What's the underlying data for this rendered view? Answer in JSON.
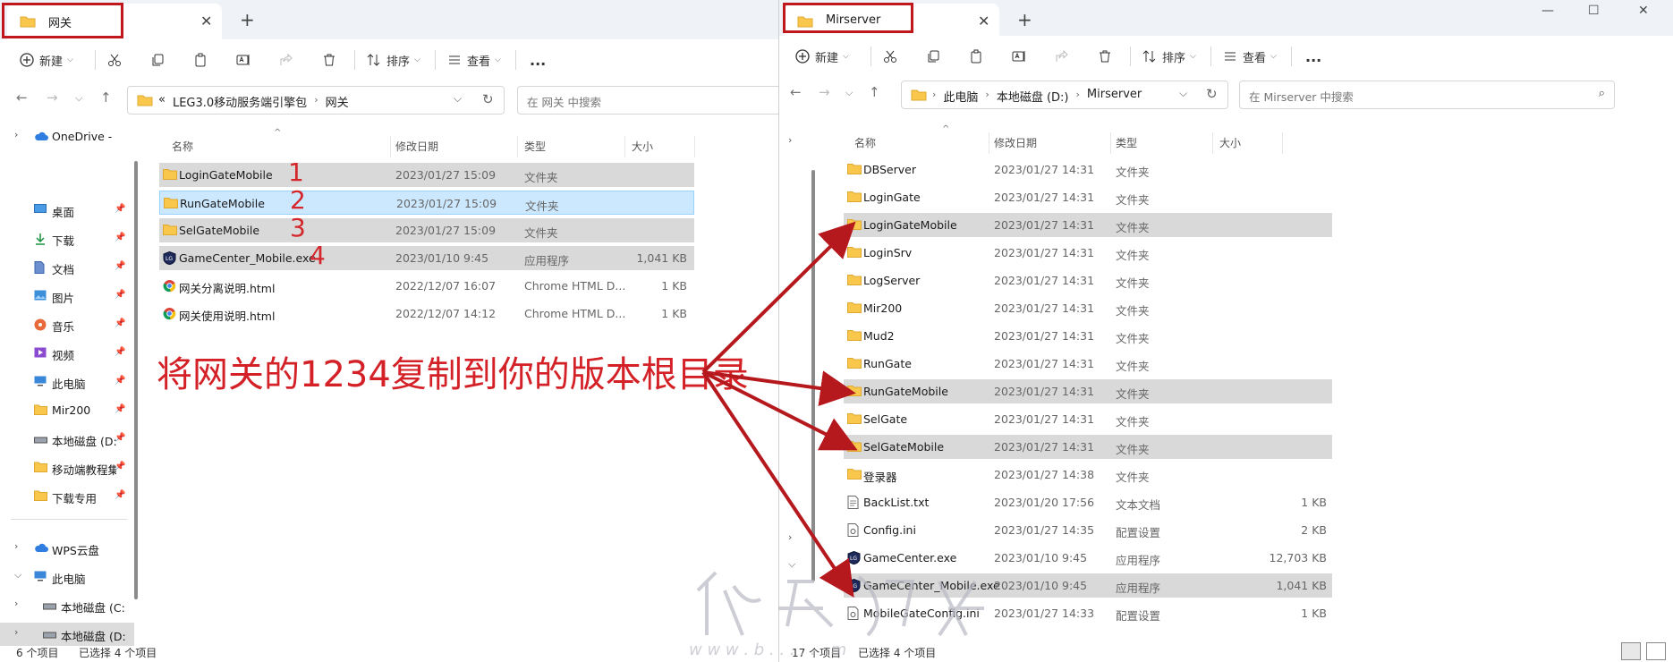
{
  "left": {
    "tab_title": "网关",
    "toolbar": {
      "new": "新建",
      "sort": "排序",
      "view": "查看",
      "more": "..."
    },
    "address": {
      "prefix": "«",
      "crumbs": [
        "LEG3.0移动服务端引擎包",
        "网关"
      ]
    },
    "search_placeholder": "在 网关 中搜索",
    "columns": {
      "name": "名称",
      "date": "修改日期",
      "type": "类型",
      "size": "大小"
    },
    "sidebar": [
      {
        "label": "OneDrive - Per",
        "icon": "cloud-icon"
      },
      {
        "label": "桌面",
        "icon": "desktop-icon"
      },
      {
        "label": "下载",
        "icon": "download-icon"
      },
      {
        "label": "文档",
        "icon": "document-icon"
      },
      {
        "label": "图片",
        "icon": "picture-icon"
      },
      {
        "label": "音乐",
        "icon": "music-icon"
      },
      {
        "label": "视频",
        "icon": "video-icon"
      },
      {
        "label": "此电脑",
        "icon": "computer-icon"
      },
      {
        "label": "Mir200",
        "icon": "folder-icon"
      },
      {
        "label": "本地磁盘 (D:",
        "icon": "drive-icon"
      },
      {
        "label": "移动端教程集",
        "icon": "folder-icon"
      },
      {
        "label": "下载专用",
        "icon": "folder-icon"
      },
      {
        "label": "WPS云盘",
        "icon": "cloud-icon"
      },
      {
        "label": "此电脑",
        "icon": "computer-icon"
      },
      {
        "label": "本地磁盘 (C:)",
        "icon": "drive-icon"
      },
      {
        "label": "本地磁盘 (D:)",
        "icon": "drive-icon"
      }
    ],
    "files": [
      {
        "name": "LoginGateMobile",
        "date": "2023/01/27 15:09",
        "type": "文件夹",
        "size": "",
        "icon": "folder",
        "state": "sel",
        "marker": "1"
      },
      {
        "name": "RunGateMobile",
        "date": "2023/01/27 15:09",
        "type": "文件夹",
        "size": "",
        "icon": "folder",
        "state": "hl",
        "marker": "2"
      },
      {
        "name": "SelGateMobile",
        "date": "2023/01/27 15:09",
        "type": "文件夹",
        "size": "",
        "icon": "folder",
        "state": "sel",
        "marker": "3"
      },
      {
        "name": "GameCenter_Mobile.exe",
        "date": "2023/01/10 9:45",
        "type": "应用程序",
        "size": "1,041 KB",
        "icon": "exe",
        "state": "sel",
        "marker": "4"
      },
      {
        "name": "网关分离说明.html",
        "date": "2022/12/07 16:07",
        "type": "Chrome HTML D...",
        "size": "1 KB",
        "icon": "chrome",
        "state": "",
        "marker": ""
      },
      {
        "name": "网关使用说明.html",
        "date": "2022/12/07 14:12",
        "type": "Chrome HTML D...",
        "size": "1 KB",
        "icon": "chrome",
        "state": "",
        "marker": ""
      }
    ],
    "status": {
      "count": "6 个项目",
      "selected": "已选择 4 个项目"
    }
  },
  "right": {
    "tab_title": "Mirserver",
    "toolbar": {
      "new": "新建",
      "sort": "排序",
      "view": "查看",
      "more": "..."
    },
    "address": {
      "crumbs": [
        "此电脑",
        "本地磁盘 (D:)",
        "Mirserver"
      ]
    },
    "search_placeholder": "在 Mirserver 中搜索",
    "columns": {
      "name": "名称",
      "date": "修改日期",
      "type": "类型",
      "size": "大小"
    },
    "files": [
      {
        "name": "DBServer",
        "date": "2023/01/27 14:31",
        "type": "文件夹",
        "size": "",
        "icon": "folder",
        "state": ""
      },
      {
        "name": "LoginGate",
        "date": "2023/01/27 14:31",
        "type": "文件夹",
        "size": "",
        "icon": "folder",
        "state": ""
      },
      {
        "name": "LoginGateMobile",
        "date": "2023/01/27 14:31",
        "type": "文件夹",
        "size": "",
        "icon": "folder",
        "state": "sel"
      },
      {
        "name": "LoginSrv",
        "date": "2023/01/27 14:31",
        "type": "文件夹",
        "size": "",
        "icon": "folder",
        "state": ""
      },
      {
        "name": "LogServer",
        "date": "2023/01/27 14:31",
        "type": "文件夹",
        "size": "",
        "icon": "folder",
        "state": ""
      },
      {
        "name": "Mir200",
        "date": "2023/01/27 14:31",
        "type": "文件夹",
        "size": "",
        "icon": "folder",
        "state": ""
      },
      {
        "name": "Mud2",
        "date": "2023/01/27 14:31",
        "type": "文件夹",
        "size": "",
        "icon": "folder",
        "state": ""
      },
      {
        "name": "RunGate",
        "date": "2023/01/27 14:31",
        "type": "文件夹",
        "size": "",
        "icon": "folder",
        "state": ""
      },
      {
        "name": "RunGateMobile",
        "date": "2023/01/27 14:31",
        "type": "文件夹",
        "size": "",
        "icon": "folder",
        "state": "sel"
      },
      {
        "name": "SelGate",
        "date": "2023/01/27 14:31",
        "type": "文件夹",
        "size": "",
        "icon": "folder",
        "state": ""
      },
      {
        "name": "SelGateMobile",
        "date": "2023/01/27 14:31",
        "type": "文件夹",
        "size": "",
        "icon": "folder",
        "state": "sel"
      },
      {
        "name": "登录器",
        "date": "2023/01/27 14:38",
        "type": "文件夹",
        "size": "",
        "icon": "folder",
        "state": ""
      },
      {
        "name": "BackList.txt",
        "date": "2023/01/20 17:56",
        "type": "文本文档",
        "size": "1 KB",
        "icon": "txt",
        "state": ""
      },
      {
        "name": "Config.ini",
        "date": "2023/01/27 14:35",
        "type": "配置设置",
        "size": "2 KB",
        "icon": "ini",
        "state": ""
      },
      {
        "name": "GameCenter.exe",
        "date": "2023/01/10 9:45",
        "type": "应用程序",
        "size": "12,703 KB",
        "icon": "exe",
        "state": ""
      },
      {
        "name": "GameCenter_Mobile.exe",
        "date": "2023/01/10 9:45",
        "type": "应用程序",
        "size": "1,041 KB",
        "icon": "exe",
        "state": "sel"
      },
      {
        "name": "MobileGateConfig.ini",
        "date": "2023/01/27 14:33",
        "type": "配置设置",
        "size": "1 KB",
        "icon": "ini",
        "state": ""
      }
    ],
    "status": {
      "count": "17 个项目",
      "selected": "已选择 4 个项目"
    }
  },
  "annotation": "将网关的1234复制到你的版本根目录",
  "colors": {
    "accent_red": "#d42127",
    "folder": "#f8c74c",
    "selected": "#d9d9d9",
    "highlight": "#cce8ff"
  }
}
